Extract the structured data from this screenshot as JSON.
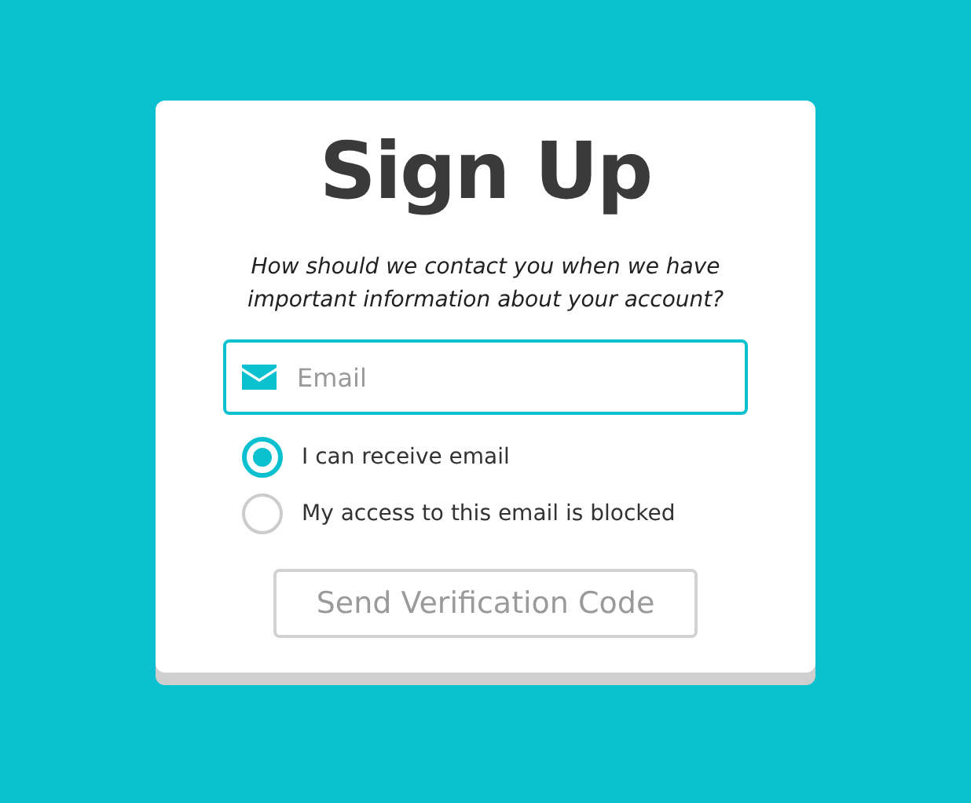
{
  "title": "Sign Up",
  "prompt": "How should we contact you when we have important information about your account?",
  "email_field": {
    "placeholder": "Email"
  },
  "options": [
    {
      "label": "I can receive email",
      "selected": true
    },
    {
      "label": "My access to this email is blocked",
      "selected": false
    }
  ],
  "submit_button": {
    "label": "Send Verification Code",
    "disabled": true
  }
}
